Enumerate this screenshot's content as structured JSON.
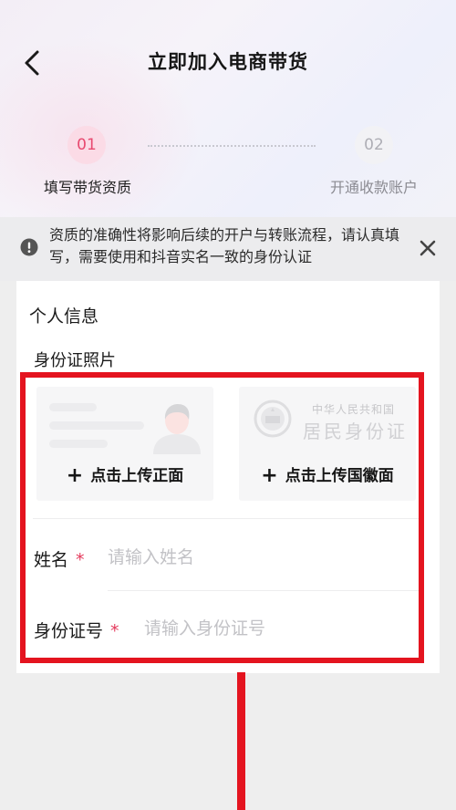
{
  "header": {
    "title": "立即加入电商带货"
  },
  "steps": [
    {
      "number": "01",
      "label": "填写带货资质"
    },
    {
      "number": "02",
      "label": "开通收款账户"
    }
  ],
  "notice": {
    "text": "资质的准确性将影响后续的开户与转账流程，请认真填写，需要使用和抖音实名一致的身份认证"
  },
  "form": {
    "section_title": "个人信息",
    "id_photo_title": "身份证照片",
    "front": {
      "upload_label": "点击上传正面"
    },
    "back": {
      "country": "中华人民共和国",
      "card_name": "居民身份证",
      "upload_label": "点击上传国徽面"
    },
    "name": {
      "label": "姓名",
      "required_mark": "*",
      "placeholder": "请输入姓名"
    },
    "id_number": {
      "label": "身份证号",
      "required_mark": "*",
      "placeholder": "请输入身份证号"
    }
  },
  "colors": {
    "accent": "#e8496f",
    "required": "#e43a5c",
    "annotation": "#e4141f"
  },
  "icons": {
    "back": "chevron-left-icon",
    "notice": "exclamation-circle-icon",
    "close": "close-icon",
    "plus": "plus-icon"
  }
}
